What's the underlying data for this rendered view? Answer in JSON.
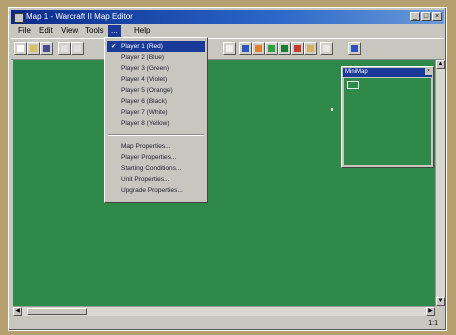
{
  "window": {
    "title": "Map 1 - Warcraft II Map Editor",
    "controls": {
      "minimize": "_",
      "maximize": "□",
      "close": "×"
    }
  },
  "menubar": {
    "items": [
      {
        "label": "File"
      },
      {
        "label": "Edit"
      },
      {
        "label": "View"
      },
      {
        "label": "Tools"
      },
      {
        "label": "..."
      },
      {
        "label": "Help"
      }
    ]
  },
  "toolbar": {
    "buttons": [
      {
        "name": "new-map-icon",
        "color": "#ffffff"
      },
      {
        "name": "open-map-icon",
        "color": "#d8c060"
      },
      {
        "name": "save-map-icon",
        "color": "#4a4a90"
      },
      {
        "name": "cut-icon",
        "color": "#e0e0e0"
      },
      {
        "name": "copy-icon",
        "color": "#e0e0e0"
      },
      {
        "name": "grid-icon",
        "color": "#f0f0f0"
      },
      {
        "name": "terrain-blue-icon",
        "color": "#2a56c0"
      },
      {
        "name": "terrain-orange-icon",
        "color": "#e08030"
      },
      {
        "name": "terrain-green-icon",
        "color": "#30a040"
      },
      {
        "name": "terrain-darkgreen-icon",
        "color": "#1e7a3a"
      },
      {
        "name": "terrain-red-icon",
        "color": "#c83a30"
      },
      {
        "name": "terrain-sand-icon",
        "color": "#d8b060"
      },
      {
        "name": "unit-icon",
        "color": "#e8e8e8"
      },
      {
        "name": "zoom-icon",
        "color": "#3050c0"
      }
    ]
  },
  "dropdown": {
    "players": [
      {
        "label": "Player 1 (Red)",
        "checked": true
      },
      {
        "label": "Player 2 (Blue)"
      },
      {
        "label": "Player 3 (Green)"
      },
      {
        "label": "Player 4 (Violet)"
      },
      {
        "label": "Player 5 (Orange)"
      },
      {
        "label": "Player 6 (Black)"
      },
      {
        "label": "Player 7 (White)"
      },
      {
        "label": "Player 8 (Yellow)"
      }
    ],
    "properties": [
      {
        "label": "Map Properties..."
      },
      {
        "label": "Player Properties..."
      },
      {
        "label": "Starting Conditions..."
      },
      {
        "label": "Unit Properties..."
      },
      {
        "label": "Upgrade Properties..."
      }
    ],
    "check_glyph": "✔"
  },
  "minimap": {
    "title": "MiniMap",
    "close": "×"
  },
  "statusbar": {
    "zoom": "1:1"
  },
  "colors": {
    "map_green": "#2f8a4a",
    "selection": "#1a3a9a",
    "title_bar": "#0a2a8a"
  }
}
